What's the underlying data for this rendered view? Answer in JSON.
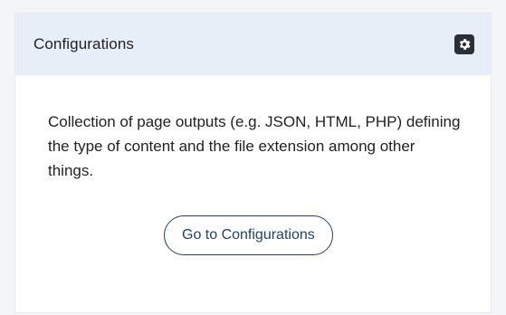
{
  "panel": {
    "title": "Configurations",
    "settings_icon": "gear-icon",
    "description": "Collection of page outputs (e.g. JSON, HTML, PHP) defining the type of content and the file extension among other things.",
    "action_label": "Go to Configurations"
  },
  "colors": {
    "header_bg": "#e8eef8",
    "button_border": "#2c3f5a",
    "button_text": "#234266",
    "icon_bg": "#2a2f38"
  }
}
